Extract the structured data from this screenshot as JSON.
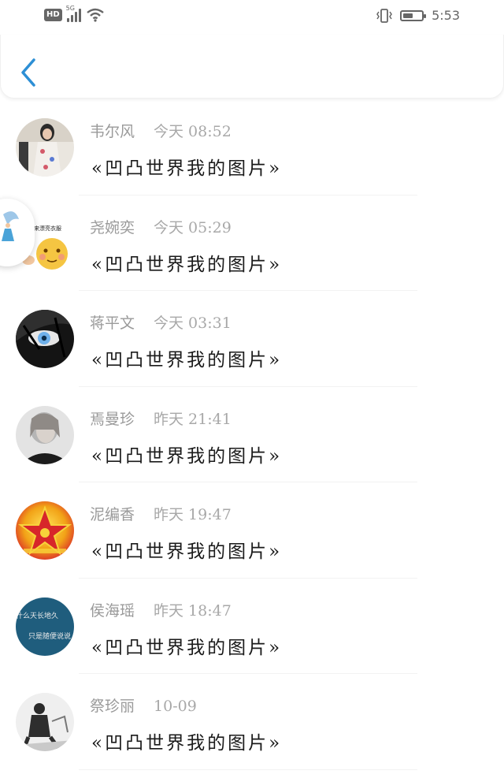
{
  "status_bar": {
    "hd": "HD",
    "network": "5G",
    "time": "5:53",
    "battery_level": 0.55,
    "icons": [
      "hd-icon",
      "signal-icon",
      "wifi-icon",
      "vibrate-icon",
      "battery-icon"
    ]
  },
  "header": {
    "back_icon": "chevron-left-icon",
    "accent": "#2d8fd5"
  },
  "items": [
    {
      "name": "韦尔风",
      "stamp": "今天 08:52",
      "title": "«凹凸世界我的图片»",
      "avatar_colors": [
        "#f3efe8",
        "#2b2b2b",
        "#d8c5b5"
      ]
    },
    {
      "name": "尧婉奕",
      "stamp": "今天 05:29",
      "title": "«凹凸世界我的图片»",
      "avatar_colors": [
        "#ffffff",
        "#f5c542",
        "#e9a23b"
      ]
    },
    {
      "name": "蒋平文",
      "stamp": "今天 03:31",
      "title": "«凹凸世界我的图片»",
      "avatar_colors": [
        "#151515",
        "#4a4a4a",
        "#7fb7e8"
      ]
    },
    {
      "name": "焉曼珍",
      "stamp": "昨天 21:41",
      "title": "«凹凸世界我的图片»",
      "avatar_colors": [
        "#d8d8d8",
        "#1d1d1d",
        "#8e8e8e"
      ]
    },
    {
      "name": "泥编香",
      "stamp": "昨天 19:47",
      "title": "«凹凸世界我的图片»",
      "avatar_colors": [
        "#f4c21a",
        "#d9242a",
        "#ff8d1b"
      ]
    },
    {
      "name": "侯海瑶",
      "stamp": "昨天 18:47",
      "title": "«凹凸世界我的图片»",
      "avatar_colors": [
        "#1e5a7a",
        "#26698a",
        "#f0f0f0"
      ]
    },
    {
      "name": "祭珍丽",
      "stamp": "10-09",
      "title": "«凹凸世界我的图片»",
      "avatar_colors": [
        "#f2f2f2",
        "#303030",
        "#bdbdbd"
      ]
    }
  ],
  "avatar_texts": {
    "item_2": "我来漂亮衣服",
    "item_6_line1": "什么天长地久",
    "item_6_line2": "只是随便说说"
  }
}
